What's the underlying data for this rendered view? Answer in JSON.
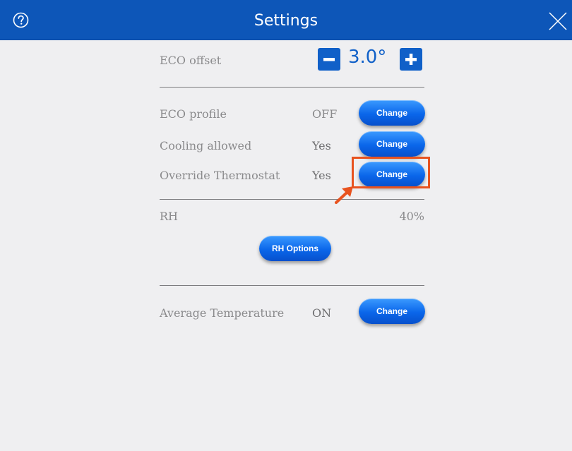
{
  "header": {
    "title": "Settings",
    "help_icon": "help-circle-icon",
    "close_icon": "close-x-icon"
  },
  "eco_offset": {
    "label": "ECO offset",
    "value": "3.0°",
    "decrement_icon": "minus-icon",
    "increment_icon": "plus-icon"
  },
  "settings_rows": [
    {
      "label": "ECO profile",
      "value": "OFF",
      "button_label": "Change"
    },
    {
      "label": "Cooling allowed",
      "value": "Yes",
      "button_label": "Change"
    },
    {
      "label": "Override Thermostat",
      "value": "Yes",
      "button_label": "Change"
    }
  ],
  "rh": {
    "label": "RH",
    "value": "40%",
    "options_button_label": "RH Options"
  },
  "average_temperature": {
    "label": "Average Temperature",
    "value": "ON",
    "button_label": "Change"
  },
  "colors": {
    "header": "#0d56b8",
    "accent": "#1060c8",
    "highlight": "#e8531f",
    "background": "#efeff1"
  }
}
